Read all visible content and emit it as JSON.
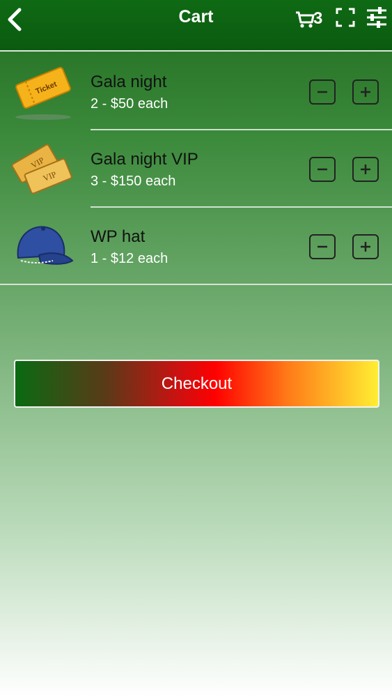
{
  "header": {
    "title": "Cart",
    "cart_count": "3"
  },
  "items": [
    {
      "name": "Gala night",
      "quantity": "2 - $50 each",
      "icon": "ticket-icon"
    },
    {
      "name": "Gala night VIP",
      "quantity": "3 - $150 each",
      "icon": "vip-tickets-icon"
    },
    {
      "name": "WP hat",
      "quantity": "1 - $12 each",
      "icon": "cap-icon"
    }
  ],
  "ticket_text": "Ticket",
  "vip_text": "VIP",
  "checkout_label": "Checkout",
  "colors": {
    "header": "#0b5a10",
    "accent_green": "#0a6a12",
    "accent_red": "#ff0000",
    "accent_yellow": "#ffee33"
  }
}
